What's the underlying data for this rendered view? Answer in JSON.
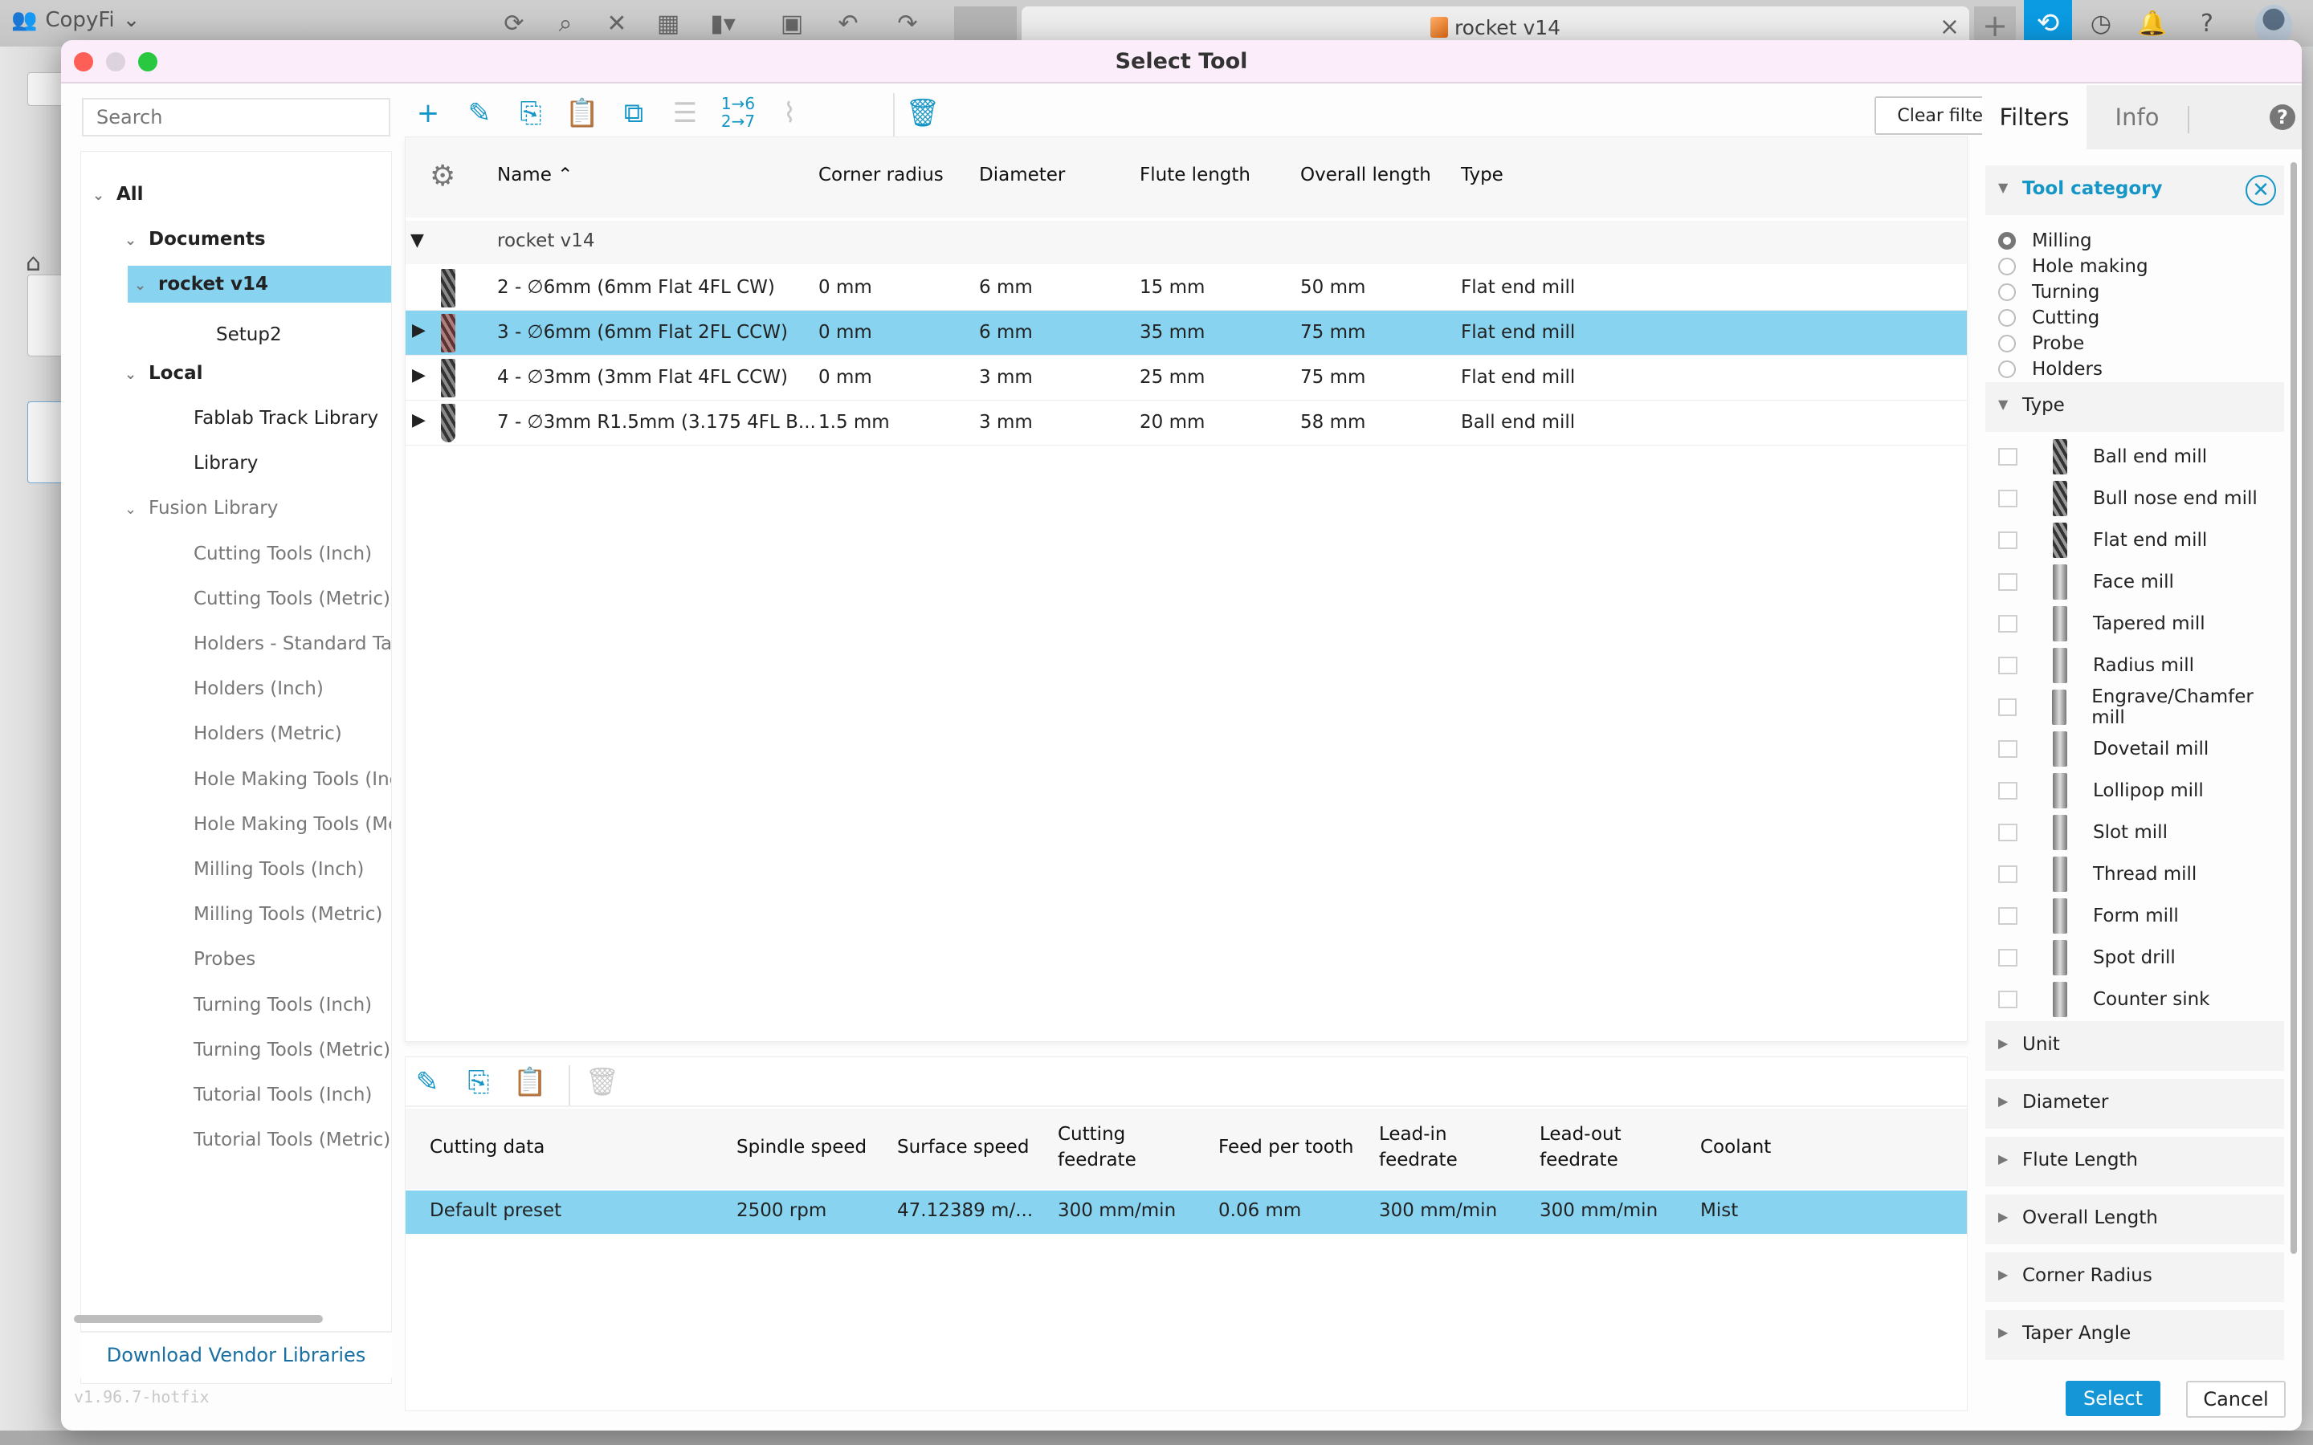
{
  "app": {
    "team_name": "CopyFi",
    "document_tab": "rocket v14",
    "toolbar_icons": [
      "refresh-icon",
      "search-icon",
      "close-icon",
      "grid-icon",
      "file-icon",
      "save-icon",
      "undo-icon",
      "redo-icon"
    ],
    "right_icons": [
      "jobs-icon",
      "clock-icon",
      "bell-icon",
      "help-icon",
      "avatar"
    ]
  },
  "dialog": {
    "title": "Select Tool",
    "search_placeholder": "Search",
    "tree": [
      {
        "label": "All",
        "level": 0,
        "expanded": true,
        "bold": true
      },
      {
        "label": "Documents",
        "level": 1,
        "expanded": true,
        "bold": true
      },
      {
        "label": "rocket v14",
        "level": 2,
        "expanded": true,
        "bold": true,
        "selected": true
      },
      {
        "label": "Setup2",
        "level": 3
      },
      {
        "label": "Local",
        "level": 1,
        "expanded": true,
        "bold": true
      },
      {
        "label": "Fablab Track Library",
        "level": 2
      },
      {
        "label": "Library",
        "level": 2
      },
      {
        "label": "Fusion Library",
        "level": 1,
        "expanded": true,
        "grey": true
      },
      {
        "label": "Cutting Tools (Inch)",
        "level": 2,
        "grey": true
      },
      {
        "label": "Cutting Tools (Metric)",
        "level": 2,
        "grey": true
      },
      {
        "label": "Holders - Standard Taper",
        "level": 2,
        "grey": true
      },
      {
        "label": "Holders (Inch)",
        "level": 2,
        "grey": true
      },
      {
        "label": "Holders (Metric)",
        "level": 2,
        "grey": true
      },
      {
        "label": "Hole Making Tools (Inch)",
        "level": 2,
        "grey": true
      },
      {
        "label": "Hole Making Tools (Metric)",
        "level": 2,
        "grey": true
      },
      {
        "label": "Milling Tools (Inch)",
        "level": 2,
        "grey": true
      },
      {
        "label": "Milling Tools (Metric)",
        "level": 2,
        "grey": true
      },
      {
        "label": "Probes",
        "level": 2,
        "grey": true
      },
      {
        "label": "Turning Tools (Inch)",
        "level": 2,
        "grey": true
      },
      {
        "label": "Turning Tools (Metric)",
        "level": 2,
        "grey": true
      },
      {
        "label": "Tutorial Tools (Inch)",
        "level": 2,
        "grey": true
      },
      {
        "label": "Tutorial Tools (Metric)",
        "level": 2,
        "grey": true
      }
    ],
    "vendor_link": "Download Vendor Libraries",
    "version": "v1.96.7-hotfix",
    "toolbar": {
      "buttons": [
        {
          "name": "new-tool-button",
          "glyph": "+",
          "enabled": true
        },
        {
          "name": "edit-tool-button",
          "glyph": "✎",
          "enabled": true
        },
        {
          "name": "copy-tool-button",
          "glyph": "⎘",
          "enabled": true
        },
        {
          "name": "paste-tool-button",
          "glyph": "📋",
          "enabled": false
        },
        {
          "name": "duplicate-tool-button",
          "glyph": "⧉",
          "enabled": true
        },
        {
          "name": "holder-button",
          "glyph": "☰",
          "enabled": false
        },
        {
          "name": "renumber-button",
          "glyph": "1→6",
          "enabled": true
        },
        {
          "name": "cleanup-button",
          "glyph": "⌇",
          "enabled": false
        },
        {
          "name": "delete-tool-button",
          "glyph": "🗑",
          "enabled": true
        }
      ],
      "clear_filters": "Clear filters"
    },
    "table": {
      "columns": [
        "Name",
        "Corner radius",
        "Diameter",
        "Flute length",
        "Overall length",
        "Type"
      ],
      "sort_column": "Name",
      "sort_dir": "asc",
      "group": "rocket v14",
      "rows": [
        {
          "name": "2 - ∅6mm (6mm Flat 4FL CW)",
          "corner_radius": "0 mm",
          "diameter": "6 mm",
          "flute_length": "15 mm",
          "overall_length": "50 mm",
          "type": "Flat end mill",
          "expandable": false,
          "selected": false
        },
        {
          "name": "3 - ∅6mm (6mm Flat 2FL CCW)",
          "corner_radius": "0 mm",
          "diameter": "6 mm",
          "flute_length": "35 mm",
          "overall_length": "75 mm",
          "type": "Flat end mill",
          "expandable": true,
          "selected": true
        },
        {
          "name": "4 - ∅3mm (3mm Flat 4FL CCW)",
          "corner_radius": "0 mm",
          "diameter": "3 mm",
          "flute_length": "25 mm",
          "overall_length": "75 mm",
          "type": "Flat end mill",
          "expandable": true,
          "selected": false
        },
        {
          "name": "7 - ∅3mm R1.5mm (3.175 4FL B...",
          "corner_radius": "1.5 mm",
          "diameter": "3 mm",
          "flute_length": "20 mm",
          "overall_length": "58 mm",
          "type": "Ball end mill",
          "expandable": true,
          "selected": false
        }
      ]
    },
    "cutting_data": {
      "toolbar": [
        {
          "name": "edit-preset-button",
          "glyph": "✎",
          "enabled": true
        },
        {
          "name": "copy-preset-button",
          "glyph": "⎘",
          "enabled": true
        },
        {
          "name": "paste-preset-button",
          "glyph": "📋",
          "enabled": false
        },
        {
          "name": "delete-preset-button",
          "glyph": "🗑",
          "enabled": false
        }
      ],
      "columns": [
        {
          "l1": "Cutting data",
          "l2": ""
        },
        {
          "l1": "Spindle speed",
          "l2": ""
        },
        {
          "l1": "Surface speed",
          "l2": ""
        },
        {
          "l1": "Cutting",
          "l2": "feedrate"
        },
        {
          "l1": "Feed per tooth",
          "l2": ""
        },
        {
          "l1": "Lead-in",
          "l2": "feedrate"
        },
        {
          "l1": "Lead-out",
          "l2": "feedrate"
        },
        {
          "l1": "Coolant",
          "l2": ""
        }
      ],
      "rows": [
        [
          "Default preset",
          "2500 rpm",
          "47.12389 m/...",
          "300 mm/min",
          "0.06 mm",
          "300 mm/min",
          "300 mm/min",
          "Mist"
        ]
      ]
    },
    "filters": {
      "tabs": [
        "Filters",
        "Info"
      ],
      "active_tab": "Filters",
      "tool_category": {
        "label": "Tool category",
        "options": [
          "Milling",
          "Hole making",
          "Turning",
          "Cutting",
          "Probe",
          "Holders"
        ],
        "selected": "Milling"
      },
      "type": {
        "label": "Type",
        "options": [
          "Ball end mill",
          "Bull nose end mill",
          "Flat end mill",
          "Face mill",
          "Tapered mill",
          "Radius mill",
          "Engrave/Chamfer mill",
          "Dovetail mill",
          "Lollipop mill",
          "Slot mill",
          "Thread mill",
          "Form mill",
          "Spot drill",
          "Counter sink"
        ]
      },
      "collapsed_sections": [
        "Unit",
        "Diameter",
        "Flute Length",
        "Overall Length",
        "Corner Radius",
        "Taper Angle"
      ]
    },
    "buttons": {
      "select": "Select",
      "cancel": "Cancel"
    }
  },
  "colors": {
    "accent": "#1596c6",
    "selection": "#87d3f0",
    "titlebar": "#fbedfa",
    "primary_button": "#1596d6"
  }
}
